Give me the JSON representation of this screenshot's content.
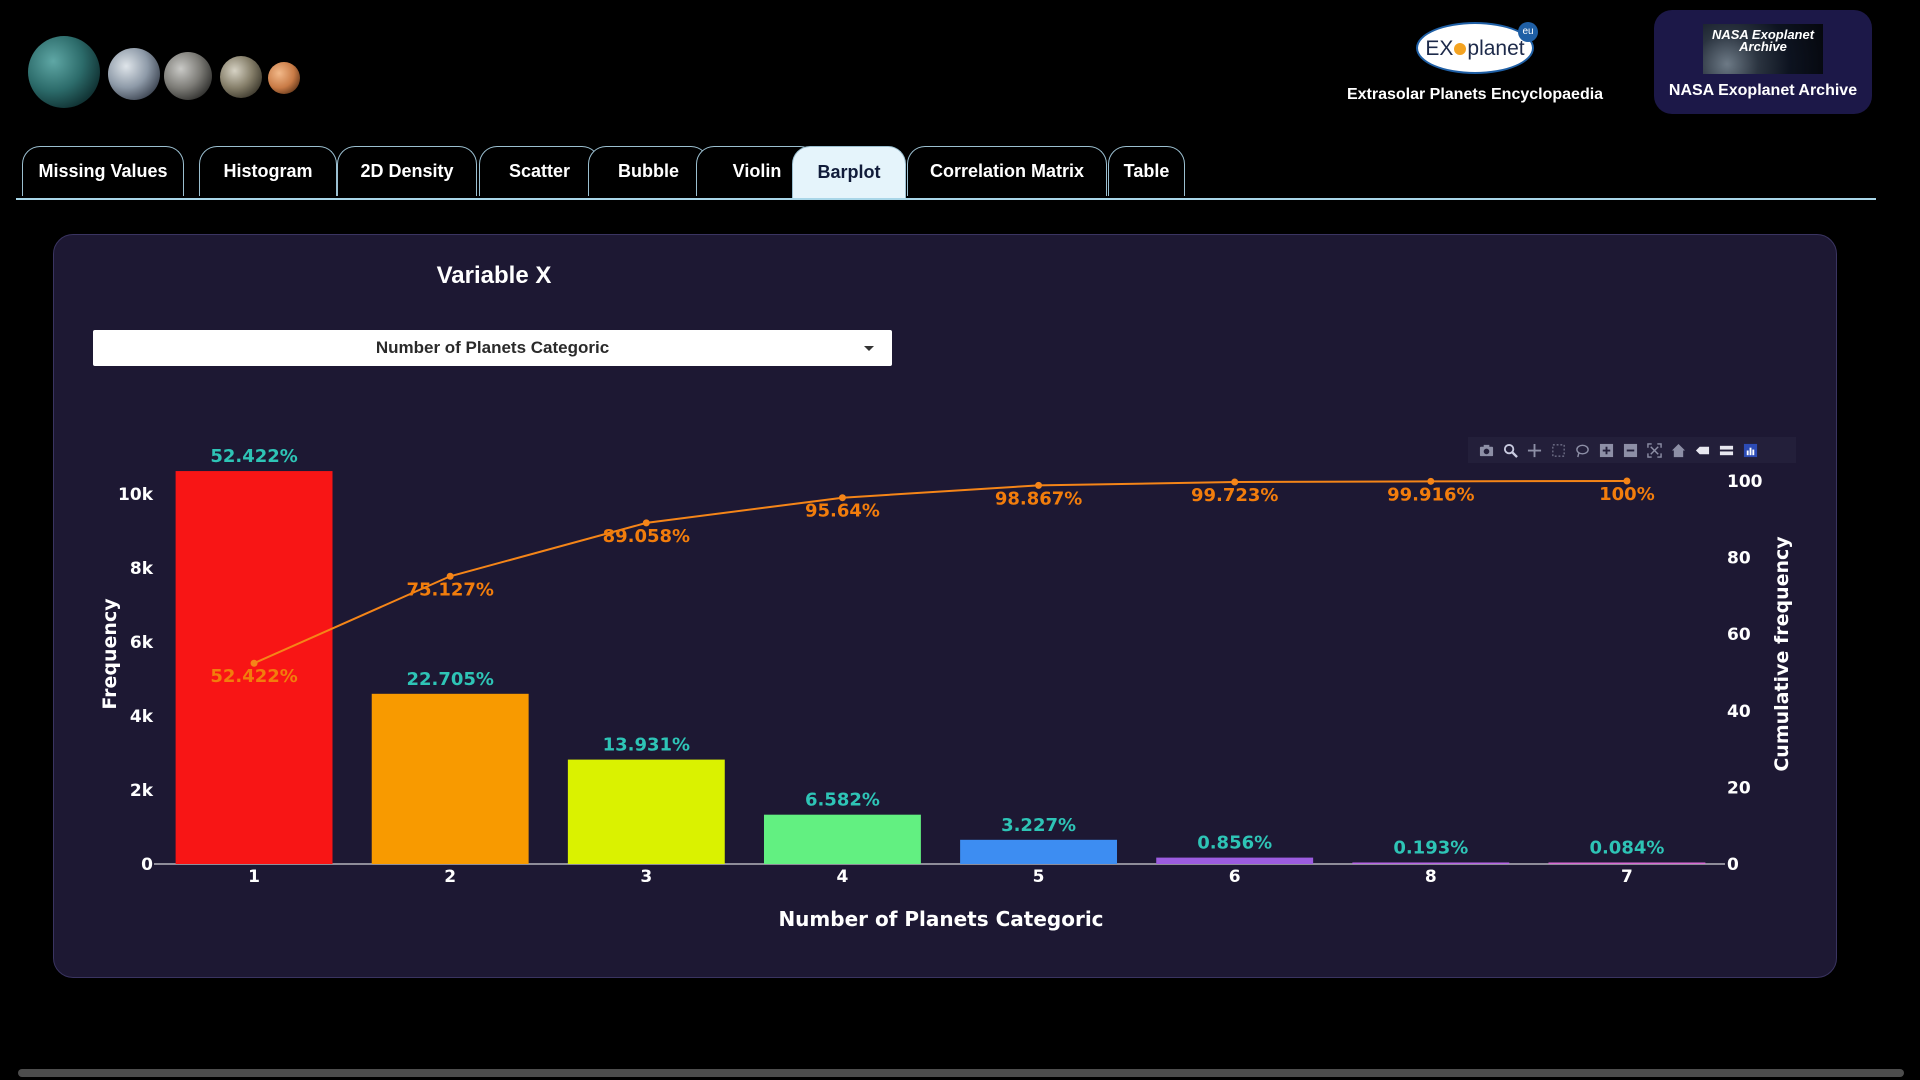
{
  "header": {
    "exo_logo_text_left": "EX",
    "exo_logo_text_right": "planet",
    "exo_badge": "eu",
    "exo_caption": "Extrasolar Planets Encyclopaedia",
    "nasa_logo_text": "NASA Exoplanet Archive",
    "nasa_caption": "NASA Exoplanet Archive"
  },
  "tabs": [
    {
      "label": "Missing Values"
    },
    {
      "label": "Histogram"
    },
    {
      "label": "2D Density"
    },
    {
      "label": "Scatter"
    },
    {
      "label": "Bubble"
    },
    {
      "label": "Violin"
    },
    {
      "label": "Barplot"
    },
    {
      "label": "Correlation Matrix"
    },
    {
      "label": "Table"
    }
  ],
  "active_tab": "Barplot",
  "panel": {
    "title": "Variable X",
    "dropdown_value": "Number of Planets Categoric"
  },
  "colors": {
    "card_bg": "#1d1833",
    "line": "#f58518",
    "pct_label": "#2ec4b6",
    "cum_label": "#f27d0c"
  },
  "chart_data": {
    "type": "bar",
    "categories": [
      "1",
      "2",
      "3",
      "4",
      "5",
      "6",
      "8",
      "7"
    ],
    "values": [
      10620,
      4600,
      2822,
      1333,
      654,
      173,
      39,
      17
    ],
    "percent_labels": [
      "52.422%",
      "22.705%",
      "13.931%",
      "6.582%",
      "3.227%",
      "0.856%",
      "0.193%",
      "0.084%"
    ],
    "bar_colors": [
      "#f81515",
      "#f89a00",
      "#daf200",
      "#62f081",
      "#3d8df2",
      "#9c5ce0",
      "#b766e6",
      "#d86bd4"
    ],
    "cumulative": [
      52.422,
      75.127,
      89.058,
      95.64,
      98.867,
      99.723,
      99.916,
      100
    ],
    "cumulative_labels": [
      "52.422%",
      "75.127%",
      "89.058%",
      "95.64%",
      "98.867%",
      "99.723%",
      "99.916%",
      "100%"
    ],
    "xlabel": "Number of Planets Categoric",
    "ylabel": "Frequency",
    "y2label": "Cumulative frequency",
    "ylim": [
      0,
      11000
    ],
    "y2lim": [
      0,
      100
    ],
    "yticks": [
      0,
      2000,
      4000,
      6000,
      8000,
      10000
    ],
    "ytick_labels": [
      "0",
      "2k",
      "4k",
      "6k",
      "8k",
      "10k"
    ],
    "y2ticks": [
      0,
      20,
      40,
      60,
      80,
      100
    ],
    "y2tick_labels": [
      "0",
      "20",
      "40",
      "60",
      "80",
      "100"
    ]
  },
  "modebar": [
    "camera-icon",
    "zoom-icon",
    "pan-icon",
    "box-select-icon",
    "lasso-icon",
    "zoom-in-icon",
    "zoom-out-icon",
    "autoscale-icon",
    "home-icon",
    "spike-lines-icon",
    "compare-hover-icon",
    "plotly-logo-icon"
  ]
}
